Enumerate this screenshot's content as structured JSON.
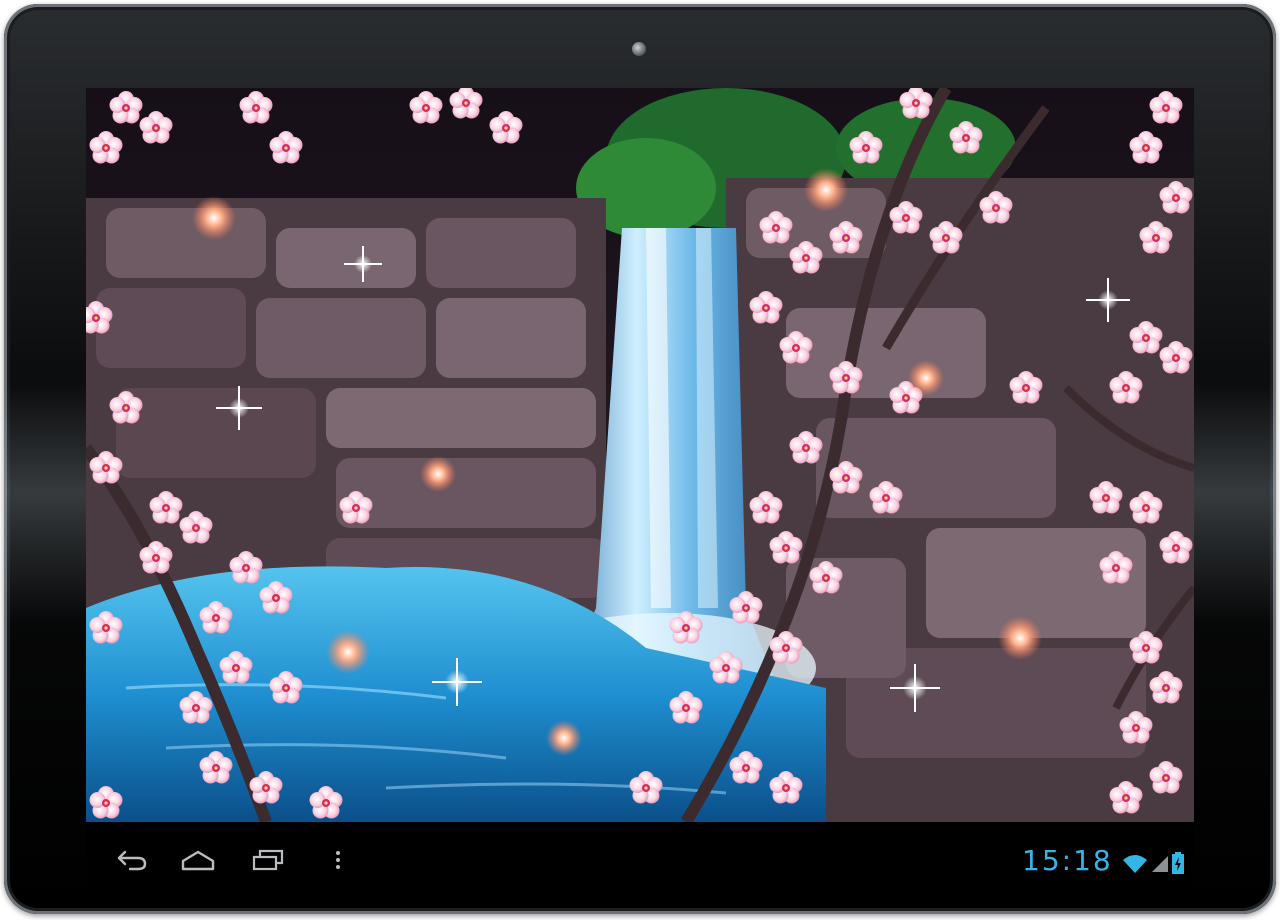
{
  "status_bar": {
    "time": "15:18",
    "wifi_icon": "wifi-icon",
    "signal_icon": "signal-icon",
    "battery_icon": "battery-charging-icon"
  },
  "navigation_bar": {
    "buttons": [
      {
        "name": "back-button",
        "icon": "back-arrow-icon"
      },
      {
        "name": "home-button",
        "icon": "home-icon"
      },
      {
        "name": "recent-apps-button",
        "icon": "recent-apps-icon"
      },
      {
        "name": "menu-button",
        "icon": "overflow-menu-icon"
      }
    ]
  },
  "colors": {
    "accent": "#33b5e5",
    "nav_icon": "#b9bdc0",
    "water": "#1f8fd1",
    "blossom": "#f6c3d8",
    "rock": "#6e5a62"
  }
}
